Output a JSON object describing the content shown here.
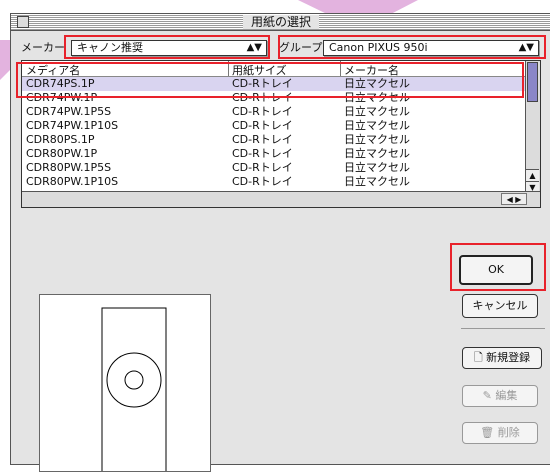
{
  "window": {
    "title": "用紙の選択"
  },
  "maker": {
    "label": "メーカー",
    "value": "キャノン推奨"
  },
  "group": {
    "label": "グループ",
    "value": "Canon PIXUS 950i"
  },
  "table": {
    "headers": [
      "メディア名",
      "用紙サイズ",
      "メーカー名"
    ],
    "rows": [
      [
        "CDR74PS.1P",
        "CD-Rトレイ",
        "日立マクセル"
      ],
      [
        "CDR74PW.1P",
        "CD-Rトレイ",
        "日立マクセル"
      ],
      [
        "CDR74PW.1P5S",
        "CD-Rトレイ",
        "日立マクセル"
      ],
      [
        "CDR74PW.1P10S",
        "CD-Rトレイ",
        "日立マクセル"
      ],
      [
        "CDR80PS.1P",
        "CD-Rトレイ",
        "日立マクセル"
      ],
      [
        "CDR80PW.1P",
        "CD-Rトレイ",
        "日立マクセル"
      ],
      [
        "CDR80PW.1P5S",
        "CD-Rトレイ",
        "日立マクセル"
      ],
      [
        "CDR80PW.1P10S",
        "CD-Rトレイ",
        "日立マクセル"
      ]
    ],
    "selected_row": "CDR74PS.1P"
  },
  "buttons": {
    "ok": "OK",
    "cancel": "キャンセル",
    "new": "新規登録",
    "edit": "編集",
    "delete": "削除"
  },
  "colors": {
    "highlight": "#e8222b",
    "pointer": "#e3b3df",
    "selection": "#d9d4f0"
  },
  "icons": [
    "close-box-icon",
    "popup-arrows-icon",
    "scroll-up-arrow-icon",
    "scroll-down-arrow-icon",
    "scroll-left-arrow-icon",
    "scroll-right-arrow-icon",
    "new-document-icon",
    "edit-icon",
    "trash-icon"
  ]
}
